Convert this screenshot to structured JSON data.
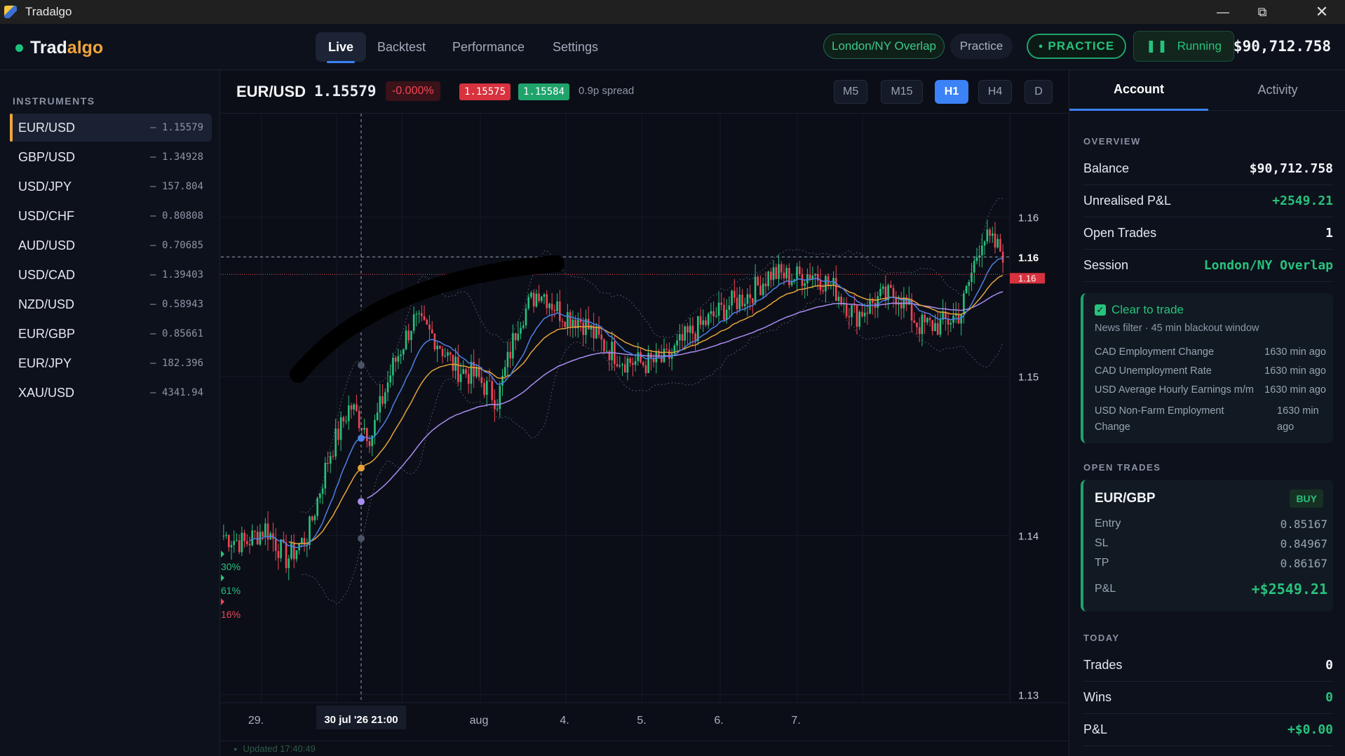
{
  "window": {
    "title": "Tradalgo",
    "app_icon": "tradalgo-app-icon",
    "controls": [
      "minimize-icon",
      "restore-icon",
      "close-icon"
    ]
  },
  "header": {
    "logo_part1": "Trad",
    "logo_part2": "algo",
    "tabs": [
      "Live",
      "Backtest",
      "Performance",
      "Settings"
    ],
    "active_tab": "Live",
    "session_pill": "London/NY Overlap",
    "mode_pill": "Practice",
    "practice_button": "PRACTICE",
    "running_button": "Running",
    "balance": "$90,712.758"
  },
  "sidebar": {
    "heading": "INSTRUMENTS",
    "items": [
      {
        "symbol": "EUR/USD",
        "price": "— 1.15579",
        "active": true
      },
      {
        "symbol": "GBP/USD",
        "price": "— 1.34928"
      },
      {
        "symbol": "USD/JPY",
        "price": "— 157.804"
      },
      {
        "symbol": "USD/CHF",
        "price": "— 0.80808"
      },
      {
        "symbol": "AUD/USD",
        "price": "— 0.70685"
      },
      {
        "symbol": "USD/CAD",
        "price": "— 1.39403"
      },
      {
        "symbol": "NZD/USD",
        "price": "— 0.58943"
      },
      {
        "symbol": "EUR/GBP",
        "price": "— 0.85661"
      },
      {
        "symbol": "EUR/JPY",
        "price": "— 182.396"
      },
      {
        "symbol": "XAU/USD",
        "price": "— 4341.94"
      }
    ]
  },
  "chart_header": {
    "pair": "EUR/USD",
    "price": "1.15579",
    "change": "-0.000%",
    "bid": "1.15575",
    "ask": "1.15584",
    "spread": "0.9p spread",
    "timeframes": [
      "M5",
      "M15",
      "H1",
      "H4",
      "D"
    ],
    "active_timeframe": "H1"
  },
  "chart_data": {
    "type": "line",
    "y_axis_labels": [
      "1.16",
      "1.16",
      "1.15",
      "1.14",
      "1.13"
    ],
    "y_levels": [
      1.16,
      1.1575,
      1.15,
      1.14,
      1.13
    ],
    "x_axis_labels": [
      "29.",
      "30.",
      "aug",
      "4.",
      "5.",
      "6.",
      "7."
    ],
    "crosshair_label": "30 jul '26   21:00",
    "current_price_tag": "1.16",
    "ylim": [
      1.1295,
      1.1665
    ],
    "percent_markers": [
      "30%",
      "61%",
      "16%"
    ],
    "series": [
      {
        "role": "price",
        "values": [
          1.14,
          1.1395,
          1.1405,
          1.1385,
          1.14,
          1.145,
          1.1482,
          1.1462,
          1.1505,
          1.1535,
          1.1525,
          1.1505,
          1.15,
          1.1485,
          1.1535,
          1.1555,
          1.154,
          1.1535,
          1.152,
          1.151,
          1.1508,
          1.151,
          1.1525,
          1.1535,
          1.1545,
          1.1552,
          1.1565,
          1.1562,
          1.1565,
          1.1555,
          1.1538,
          1.1548,
          1.1552,
          1.1532,
          1.1532,
          1.154,
          1.1588,
          1.1578
        ]
      },
      {
        "role": "ema-fast",
        "color": "#4e7fe6"
      },
      {
        "role": "ema-mid",
        "color": "#e5a33a"
      },
      {
        "role": "ema-slow",
        "color": "#a98cf0"
      }
    ]
  },
  "chart_footer": {
    "updated": "Updated 17:40:49"
  },
  "right_panel": {
    "tabs": [
      "Account",
      "Activity"
    ],
    "active_tab": "Account",
    "overview_heading": "OVERVIEW",
    "overview": [
      {
        "label": "Balance",
        "value": "$90,712.758",
        "color": "#f2f4f8"
      },
      {
        "label": "Unrealised P&L",
        "value": "+2549.21",
        "color": "#27c27d"
      },
      {
        "label": "Open Trades",
        "value": "1",
        "color": "#f2f4f8"
      },
      {
        "label": "Session",
        "value": "London/NY Overlap",
        "color": "#27c27d"
      }
    ],
    "news_card": {
      "title": "Clear to trade",
      "subtitle": "News filter · 45 min blackout window",
      "events": [
        {
          "name": "CAD Employment Change",
          "time": "1630 min ago"
        },
        {
          "name": "CAD Unemployment Rate",
          "time": "1630 min ago"
        },
        {
          "name": "USD Average Hourly Earnings m/m",
          "time": "1630 min ago"
        },
        {
          "name": "USD Non-Farm Employment Change",
          "time": "1630 min ago"
        }
      ]
    },
    "open_trades_heading": "OPEN TRADES",
    "open_trade": {
      "pair": "EUR/GBP",
      "side": "BUY",
      "rows": [
        {
          "label": "Entry",
          "value": "0.85167"
        },
        {
          "label": "SL",
          "value": "0.84967"
        },
        {
          "label": "TP",
          "value": "0.86167"
        }
      ],
      "pnl_label": "P&L",
      "pnl_value": "+$2549.21"
    },
    "today_heading": "TODAY",
    "today": [
      {
        "label": "Trades",
        "value": "0",
        "color": "#f2f4f8"
      },
      {
        "label": "Wins",
        "value": "0",
        "color": "#27c27d"
      },
      {
        "label": "P&L",
        "value": "+$0.00",
        "color": "#27c27d"
      }
    ]
  }
}
